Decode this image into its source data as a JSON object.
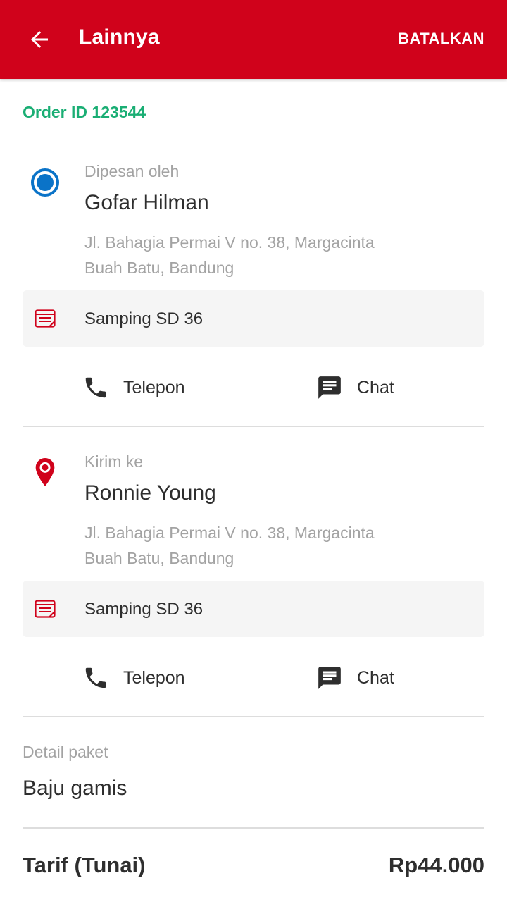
{
  "appbar": {
    "title": "Lainnya",
    "cancel_label": "BATALKAN",
    "color": "#d0021b"
  },
  "order": {
    "id_text": "Order ID 123544"
  },
  "sender": {
    "label": "Dipesan oleh",
    "name": "Gofar Hilman",
    "address_line1": "Jl. Bahagia Permai V no. 38, Margacinta",
    "address_line2": "Buah Batu, Bandung",
    "note": "Samping SD 36",
    "call_label": "Telepon",
    "chat_label": "Chat",
    "marker_icon": "radio-origin-icon",
    "marker_color": "#0a73c8"
  },
  "receiver": {
    "label": "Kirim ke",
    "name": "Ronnie Young",
    "address_line1": "Jl. Bahagia Permai V no. 38, Margacinta",
    "address_line2": "Buah Batu, Bandung",
    "note": "Samping SD 36",
    "call_label": "Telepon",
    "chat_label": "Chat",
    "marker_icon": "location-pin-icon",
    "marker_color": "#d0021b"
  },
  "package": {
    "label": "Detail paket",
    "value": "Baju gamis"
  },
  "fare": {
    "label": "Tarif (Tunai)",
    "value": "Rp44.000"
  },
  "colors": {
    "accent_green": "#1aae74",
    "muted_text": "#a3a3a3",
    "note_bg": "#f5f5f5"
  }
}
